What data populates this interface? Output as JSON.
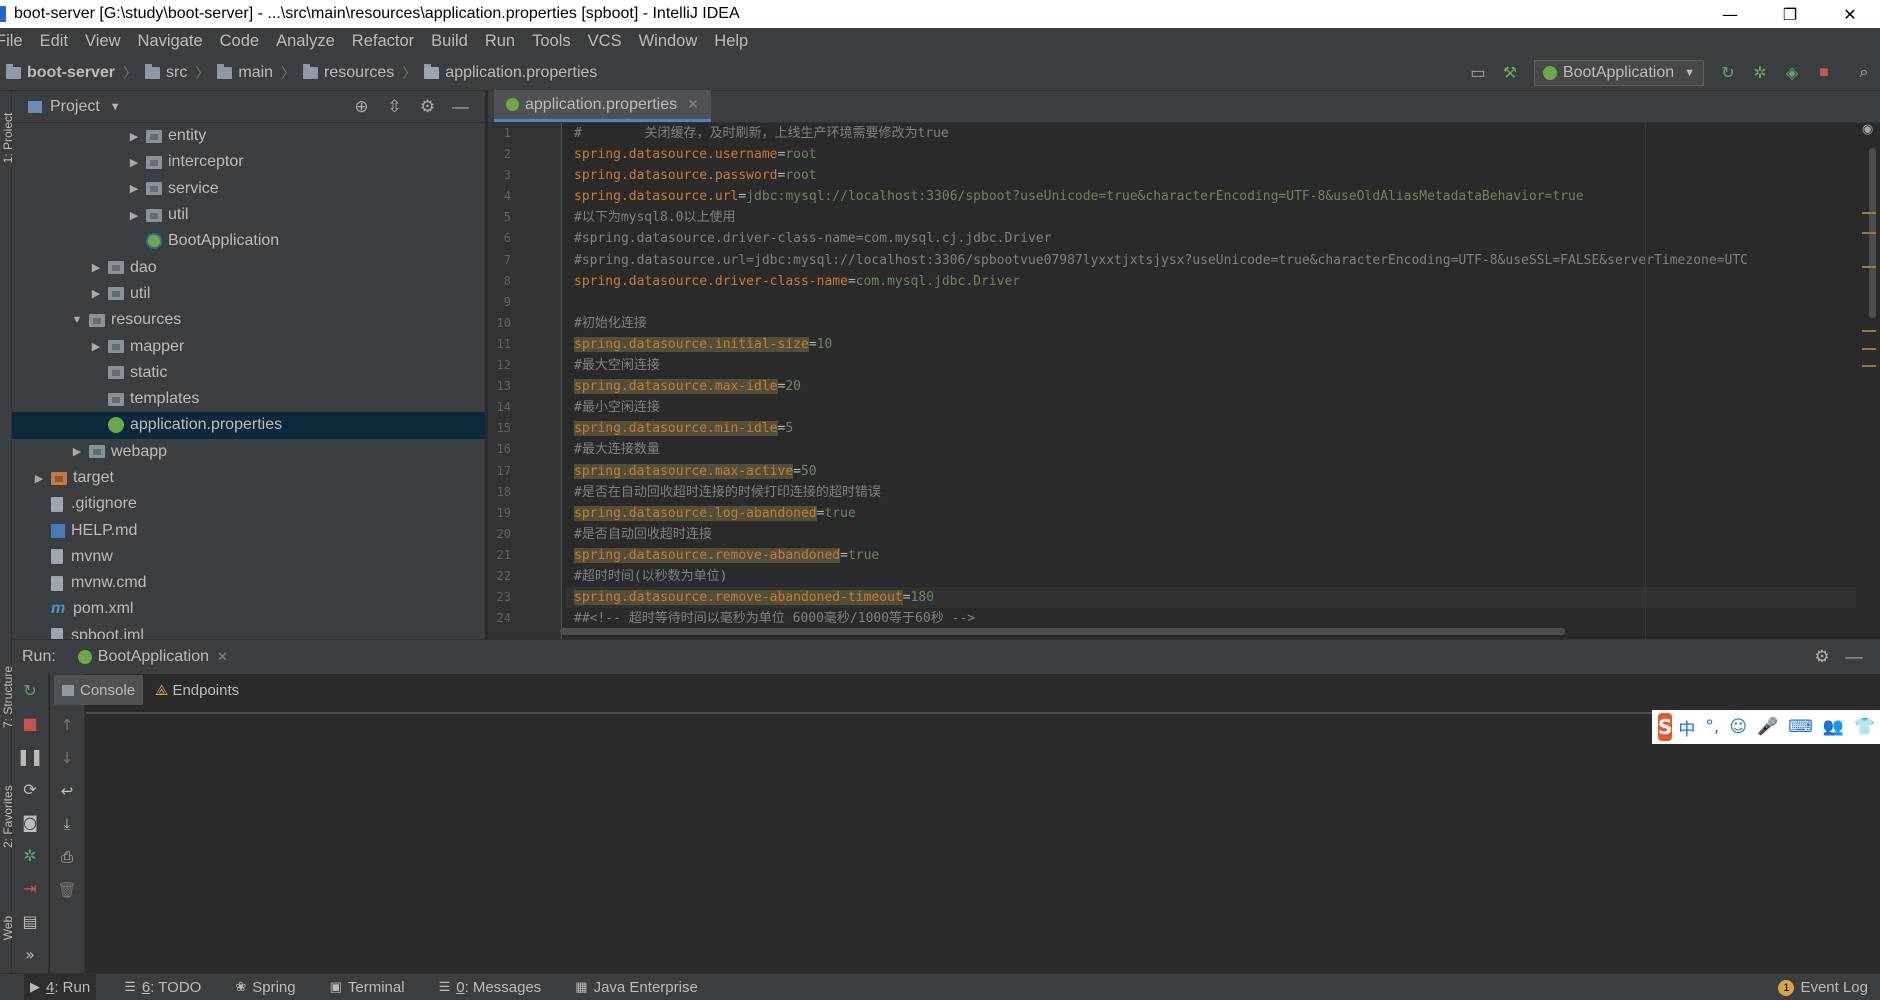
{
  "window": {
    "title": "boot-server [G:\\study\\boot-server] - ...\\src\\main\\resources\\application.properties [spboot] - IntelliJ IDEA",
    "controls": [
      "—",
      "❐",
      "✕"
    ]
  },
  "menu": [
    "File",
    "Edit",
    "View",
    "Navigate",
    "Code",
    "Analyze",
    "Refactor",
    "Build",
    "Run",
    "Tools",
    "VCS",
    "Window",
    "Help"
  ],
  "breadcrumb": [
    "boot-server",
    "src",
    "main",
    "resources",
    "application.properties"
  ],
  "toolbar": {
    "run_config": "BootApplication"
  },
  "project_panel": {
    "title": "Project",
    "tree": [
      {
        "label": "entity",
        "indent": 6,
        "type": "folder",
        "arrow": "▶"
      },
      {
        "label": "interceptor",
        "indent": 6,
        "type": "folder",
        "arrow": "▶"
      },
      {
        "label": "service",
        "indent": 6,
        "type": "folder",
        "arrow": "▶"
      },
      {
        "label": "util",
        "indent": 6,
        "type": "folder",
        "arrow": "▶"
      },
      {
        "label": "BootApplication",
        "indent": 6,
        "type": "app",
        "arrow": ""
      },
      {
        "label": "dao",
        "indent": 4,
        "type": "folder",
        "arrow": "▶"
      },
      {
        "label": "util",
        "indent": 4,
        "type": "folder",
        "arrow": "▶"
      },
      {
        "label": "resources",
        "indent": 3,
        "type": "res",
        "arrow": "▼"
      },
      {
        "label": "mapper",
        "indent": 4,
        "type": "folder",
        "arrow": "▶"
      },
      {
        "label": "static",
        "indent": 4,
        "type": "folder",
        "arrow": ""
      },
      {
        "label": "templates",
        "indent": 4,
        "type": "folder",
        "arrow": ""
      },
      {
        "label": "application.properties",
        "indent": 4,
        "type": "spring",
        "arrow": "",
        "selected": true
      },
      {
        "label": "webapp",
        "indent": 3,
        "type": "folder",
        "arrow": "▶"
      },
      {
        "label": "target",
        "indent": 1,
        "type": "orange",
        "arrow": "▶"
      },
      {
        "label": ".gitignore",
        "indent": 1,
        "type": "file",
        "arrow": ""
      },
      {
        "label": "HELP.md",
        "indent": 1,
        "type": "md",
        "arrow": ""
      },
      {
        "label": "mvnw",
        "indent": 1,
        "type": "file",
        "arrow": ""
      },
      {
        "label": "mvnw.cmd",
        "indent": 1,
        "type": "file",
        "arrow": ""
      },
      {
        "label": "pom.xml",
        "indent": 1,
        "type": "maven",
        "arrow": ""
      },
      {
        "label": "spboot.iml",
        "indent": 1,
        "type": "file",
        "arrow": ""
      }
    ]
  },
  "editor": {
    "tab": "application.properties",
    "lines": [
      {
        "n": "1",
        "type": "comment",
        "text": "#        关闭缓存，及时刷新，上线生产环境需要修改为true"
      },
      {
        "n": "2",
        "type": "kv",
        "key": "spring.datasource.username",
        "val": "root"
      },
      {
        "n": "3",
        "type": "kv",
        "key": "spring.datasource.password",
        "val": "root"
      },
      {
        "n": "4",
        "type": "kv",
        "key": "spring.datasource.url",
        "val": "jdbc:mysql://localhost:3306/spboot?useUnicode=true&characterEncoding=UTF-8&useOldAliasMetadataBehavior=true"
      },
      {
        "n": "5",
        "type": "comment",
        "text": "#以下为mysql8.0以上使用"
      },
      {
        "n": "6",
        "type": "comment",
        "text": "#spring.datasource.driver-class-name=com.mysql.cj.jdbc.Driver"
      },
      {
        "n": "7",
        "type": "comment",
        "text": "#spring.datasource.url=jdbc:mysql://localhost:3306/spbootvue07987lyxxtjxtsjysx?useUnicode=true&characterEncoding=UTF-8&useSSL=FALSE&serverTimezone=UTC"
      },
      {
        "n": "8",
        "type": "kv",
        "key": "spring.datasource.driver-class-name",
        "val": "com.mysql.jdbc.Driver"
      },
      {
        "n": "9",
        "type": "blank",
        "text": ""
      },
      {
        "n": "10",
        "type": "comment",
        "text": "#初始化连接"
      },
      {
        "n": "11",
        "type": "hkv",
        "key": "spring.datasource.initial-size",
        "val": "10"
      },
      {
        "n": "12",
        "type": "comment",
        "text": "#最大空闲连接"
      },
      {
        "n": "13",
        "type": "hkv",
        "key": "spring.datasource.max-idle",
        "val": "20"
      },
      {
        "n": "14",
        "type": "comment",
        "text": "#最小空闲连接"
      },
      {
        "n": "15",
        "type": "hkv",
        "key": "spring.datasource.min-idle",
        "val": "5"
      },
      {
        "n": "16",
        "type": "comment",
        "text": "#最大连接数量"
      },
      {
        "n": "17",
        "type": "hkv",
        "key": "spring.datasource.max-active",
        "val": "50"
      },
      {
        "n": "18",
        "type": "comment",
        "text": "#是否在自动回收超时连接的时候打印连接的超时错误"
      },
      {
        "n": "19",
        "type": "hkv",
        "key": "spring.datasource.log-abandoned",
        "val": "true"
      },
      {
        "n": "20",
        "type": "comment",
        "text": "#是否自动回收超时连接"
      },
      {
        "n": "21",
        "type": "hkv",
        "key": "spring.datasource.remove-abandoned",
        "val": "true"
      },
      {
        "n": "22",
        "type": "comment",
        "text": "#超时时间(以秒数为单位)"
      },
      {
        "n": "23",
        "type": "hkv",
        "key": "spring.datasource.remove-abandoned-timeout",
        "val": "180",
        "current": true
      },
      {
        "n": "24",
        "type": "comment",
        "text": "##<!-- 超时等待时间以毫秒为单位 6000毫秒/1000等于60秒 -->"
      }
    ]
  },
  "run_panel": {
    "label": "Run:",
    "tab": "BootApplication",
    "subtabs": [
      "Console",
      "Endpoints"
    ]
  },
  "side_labels": {
    "project": "1: Project",
    "structure": "7: Structure",
    "favorites": "2: Favorites",
    "web": "Web"
  },
  "bottom_tools": [
    {
      "icon": "▶",
      "key": "4",
      "label": ": Run",
      "active": true
    },
    {
      "icon": "☰",
      "key": "6",
      "label": ": TODO"
    },
    {
      "icon": "❀",
      "key": "",
      "label": "Spring"
    },
    {
      "icon": "▣",
      "key": "",
      "label": "Terminal"
    },
    {
      "icon": "☰",
      "key": "0",
      "label": ": Messages"
    },
    {
      "icon": "▦",
      "key": "",
      "label": "Java Enterprise"
    }
  ],
  "event_log": {
    "count": "1",
    "label": "Event Log"
  },
  "ime": {
    "logo": "S",
    "items": [
      "中",
      "°,",
      "☺",
      "🎤",
      "⌨",
      "👥",
      "👕"
    ]
  }
}
